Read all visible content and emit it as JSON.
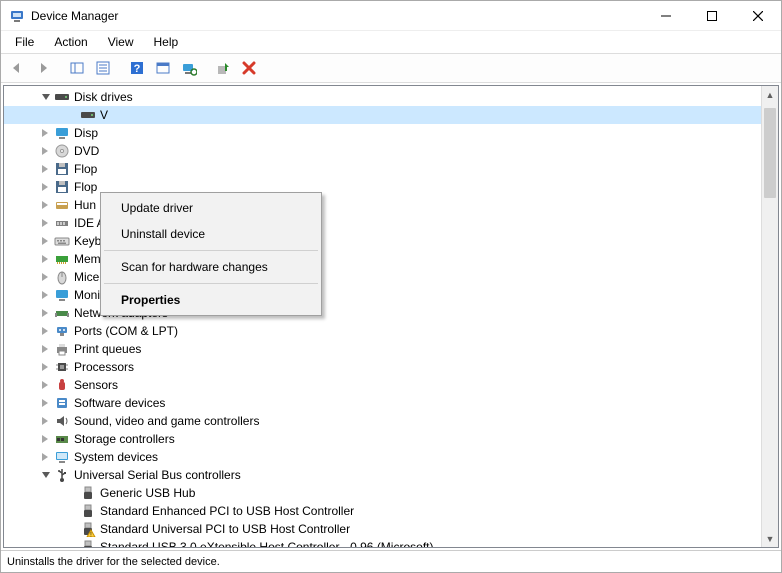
{
  "window": {
    "title": "Device Manager"
  },
  "menubar": {
    "items": [
      "File",
      "Action",
      "View",
      "Help"
    ]
  },
  "statusbar": {
    "text": "Uninstalls the driver for the selected device."
  },
  "context_menu": {
    "items": [
      {
        "label": "Update driver"
      },
      {
        "label": "Uninstall device"
      },
      {
        "sep": true
      },
      {
        "label": "Scan for hardware changes"
      },
      {
        "sep": true
      },
      {
        "label": "Properties",
        "bold": true
      }
    ]
  },
  "tree": {
    "nodes": [
      {
        "level": 0,
        "exp": "open",
        "icon": "disk-drives",
        "label": "Disk drives"
      },
      {
        "level": 1,
        "exp": "none",
        "icon": "hdd",
        "label": "V",
        "selected": true
      },
      {
        "level": 0,
        "exp": "closed",
        "icon": "display",
        "label": "Disp"
      },
      {
        "level": 0,
        "exp": "closed",
        "icon": "dvd",
        "label": "DVD"
      },
      {
        "level": 0,
        "exp": "closed",
        "icon": "floppy",
        "label": "Flop"
      },
      {
        "level": 0,
        "exp": "closed",
        "icon": "floppy",
        "label": "Flop"
      },
      {
        "level": 0,
        "exp": "closed",
        "icon": "hid",
        "label": "Hun"
      },
      {
        "level": 0,
        "exp": "closed",
        "icon": "ide",
        "label": "IDE ATA/ATAPI controllers"
      },
      {
        "level": 0,
        "exp": "closed",
        "icon": "keyboard",
        "label": "Keyboards"
      },
      {
        "level": 0,
        "exp": "closed",
        "icon": "memory",
        "label": "Memory devices"
      },
      {
        "level": 0,
        "exp": "closed",
        "icon": "mouse",
        "label": "Mice and other pointing devices"
      },
      {
        "level": 0,
        "exp": "closed",
        "icon": "monitor",
        "label": "Monitors"
      },
      {
        "level": 0,
        "exp": "closed",
        "icon": "network",
        "label": "Network adapters"
      },
      {
        "level": 0,
        "exp": "closed",
        "icon": "port",
        "label": "Ports (COM & LPT)"
      },
      {
        "level": 0,
        "exp": "closed",
        "icon": "printer",
        "label": "Print queues"
      },
      {
        "level": 0,
        "exp": "closed",
        "icon": "cpu",
        "label": "Processors"
      },
      {
        "level": 0,
        "exp": "closed",
        "icon": "sensor",
        "label": "Sensors"
      },
      {
        "level": 0,
        "exp": "closed",
        "icon": "software",
        "label": "Software devices"
      },
      {
        "level": 0,
        "exp": "closed",
        "icon": "sound",
        "label": "Sound, video and game controllers"
      },
      {
        "level": 0,
        "exp": "closed",
        "icon": "storage",
        "label": "Storage controllers"
      },
      {
        "level": 0,
        "exp": "closed",
        "icon": "system",
        "label": "System devices"
      },
      {
        "level": 0,
        "exp": "open",
        "icon": "usb",
        "label": "Universal Serial Bus controllers"
      },
      {
        "level": 1,
        "exp": "none",
        "icon": "usb-dev",
        "label": "Generic USB Hub"
      },
      {
        "level": 1,
        "exp": "none",
        "icon": "usb-dev",
        "label": "Standard Enhanced PCI to USB Host Controller"
      },
      {
        "level": 1,
        "exp": "none",
        "icon": "usb-warn",
        "label": "Standard Universal PCI to USB Host Controller"
      },
      {
        "level": 1,
        "exp": "none",
        "icon": "usb-dev",
        "label": "Standard USB 3.0 eXtensible Host Controller - 0.96 (Microsoft)"
      }
    ]
  }
}
